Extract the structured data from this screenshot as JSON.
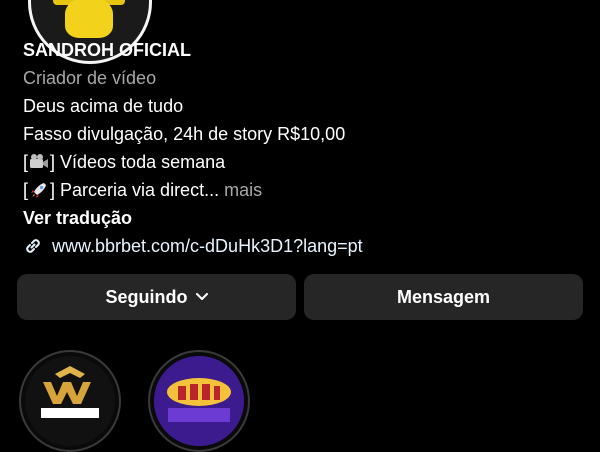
{
  "profile": {
    "name": "SANDROH OFICIAL",
    "category": "Criador de vídeo",
    "bio": {
      "line1": "Deus acima de tudo",
      "line2": "Fasso divulgação, 24h de story R$10,00",
      "line3_prefix": "[",
      "line3_suffix": "] Vídeos toda semana",
      "line4_prefix": "[",
      "line4_suffix": "] Parceria via direct",
      "ellipsis": "...",
      "more": " mais"
    },
    "translate": "Ver tradução",
    "link": "www.bbrbet.com/c-dDuHk3D1?lang=pt"
  },
  "buttons": {
    "following": "Seguindo",
    "message": "Mensagem"
  },
  "icons": {
    "link": "link-icon",
    "chevron": "chevron-down-icon",
    "film": "film-camera-icon",
    "rocket": "rocket-icon"
  },
  "colors": {
    "background": "#000000",
    "button": "#262626",
    "secondary_text": "#a8a8a8",
    "accent_yellow": "#f2d21b"
  }
}
